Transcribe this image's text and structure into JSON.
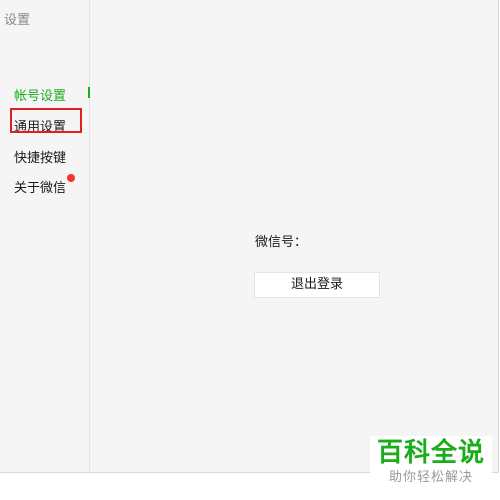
{
  "window": {
    "title": "设置"
  },
  "sidebar": {
    "items": [
      {
        "label": "帐号设置",
        "active": true
      },
      {
        "label": "通用设置",
        "active": false
      },
      {
        "label": "快捷按键",
        "active": false
      },
      {
        "label": "关于微信",
        "active": false,
        "badge": "red-dot"
      }
    ]
  },
  "account": {
    "wechat_id_label": "微信号：",
    "logout_label": "退出登录"
  },
  "watermark": {
    "main": "百科全说",
    "sub": "助你轻松解决"
  },
  "colors": {
    "accent": "#1aad19",
    "highlight": "#e02020",
    "badge": "#f43530"
  }
}
